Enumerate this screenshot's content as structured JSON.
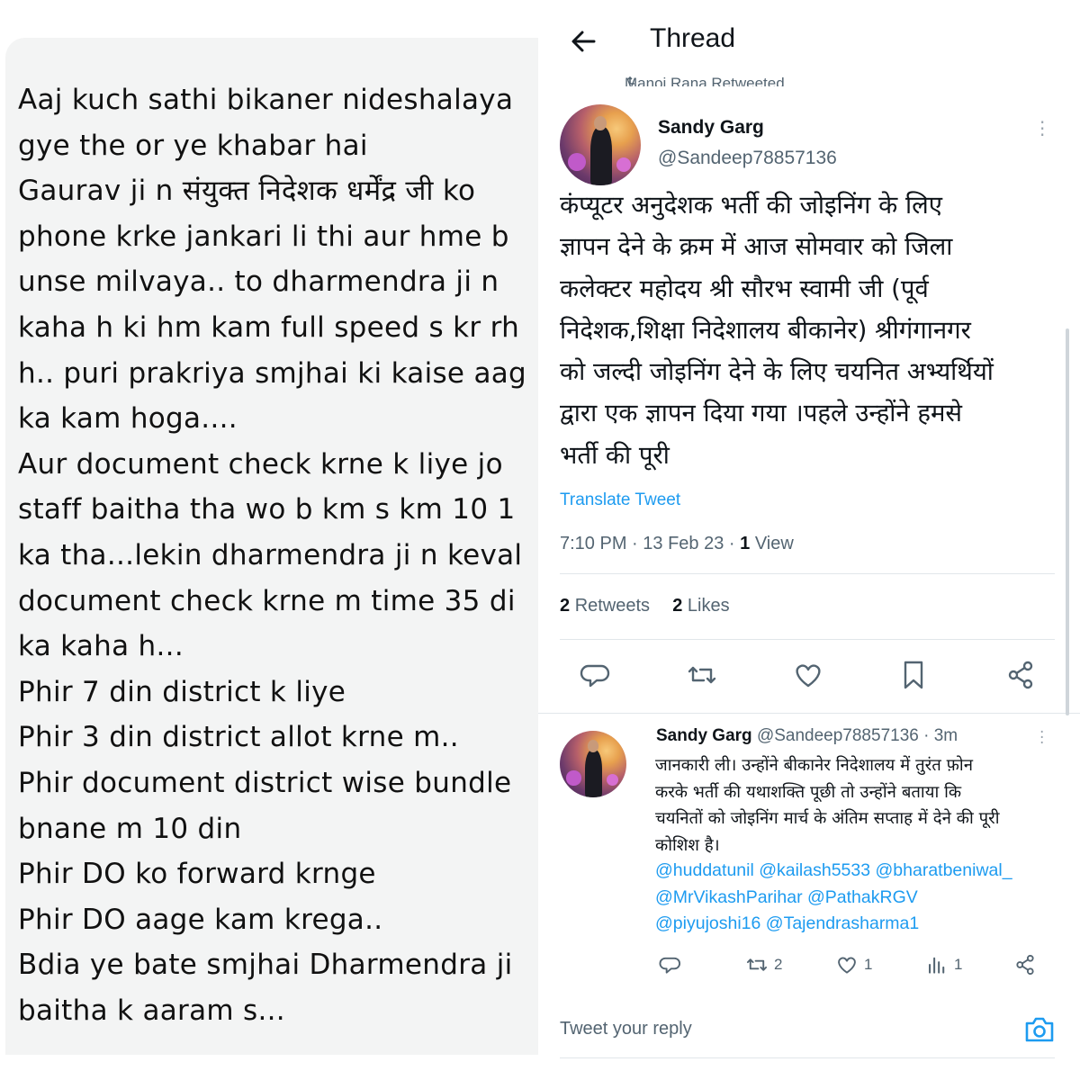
{
  "left_panel": {
    "lines": [
      "Aaj kuch sathi bikaner nideshalaya",
      "gye the or ye khabar hai",
      "Gaurav ji n संयुक्त निदेशक धर्मेंद्र जी ko",
      "phone krke jankari li thi aur hme b",
      "unse milvaya.. to dharmendra ji n",
      "kaha h ki hm kam full speed s kr rh",
      "h.. puri prakriya smjhai ki kaise aag",
      "ka kam hoga....",
      "Aur document check krne k liye jo",
      "staff baitha tha wo b km s km 10 1",
      "ka tha...lekin dharmendra ji n keval",
      "document check krne m time 35 di",
      "ka kaha h...",
      "Phir 7 din district k liye",
      "Phir 3 din district allot krne m..",
      "Phir document district wise bundle",
      "bnane m 10 din",
      "Phir DO ko forward krnge",
      "Phir DO aage kam krega..",
      "Bdia ye bate smjhai Dharmendra ji",
      "baitha k aaram s..."
    ]
  },
  "header": {
    "title": "Thread",
    "back_icon": "arrow-left-icon",
    "retweeted_by": "Manoj Rana Retweeted"
  },
  "main_tweet": {
    "author_name": "Sandy Garg",
    "author_handle": "@Sandeep78857136",
    "lines": [
      "कंप्यूटर अनुदेशक भर्ती की जोइनिंग के लिए",
      "ज्ञापन देने के क्रम में आज सोमवार को जिला",
      "कलेक्टर महोदय श्री सौरभ स्वामी जी (पूर्व",
      "निदेशक,शिक्षा निदेशालय बीकानेर) श्रीगंगानगर",
      "को जल्दी जोइनिंग देने के लिए चयनित अभ्यर्थियों",
      "द्वारा एक ज्ञापन दिया गया ।पहले उन्होंने हमसे",
      "भर्ती की पूरी"
    ],
    "translate_label": "Translate Tweet",
    "time": "7:10 PM",
    "date": "13 Feb 23",
    "views_count": "1",
    "views_label": "View",
    "retweets_count": "2",
    "retweets_label": "Retweets",
    "likes_count": "2",
    "likes_label": "Likes",
    "actions": [
      "reply-icon",
      "retweet-icon",
      "like-icon",
      "bookmark-icon",
      "share-icon"
    ]
  },
  "reply_tweet": {
    "author_name": "Sandy Garg",
    "author_handle": "@Sandeep78857136",
    "age": "· 3m",
    "lines": [
      "जानकारी ली। उन्होंने बीकानेर निदेशालय में तुरंत फ़ोन",
      "करके भर्ती की यथाशक्ति पूछी तो उन्होंने बताया कि",
      "चयनितों को जोइनिंग मार्च के अंतिम सप्ताह में देने की पूरी",
      "कोशिश है।"
    ],
    "mention_lines": [
      "@huddatunil @kailash5533 @bharatbeniwal_",
      "@MrVikashParihar  @PathakRGV",
      "@piyujoshi16 @Tajendrasharma1"
    ],
    "retweet_count": "2",
    "like_count": "1",
    "views_count": "1"
  },
  "reply_bar": {
    "placeholder": "Tweet your reply",
    "camera_icon": "camera-icon"
  },
  "colors": {
    "accent": "#1d9bf0",
    "secondary_text": "#536471",
    "left_panel_bg": "#f3f4f4"
  }
}
